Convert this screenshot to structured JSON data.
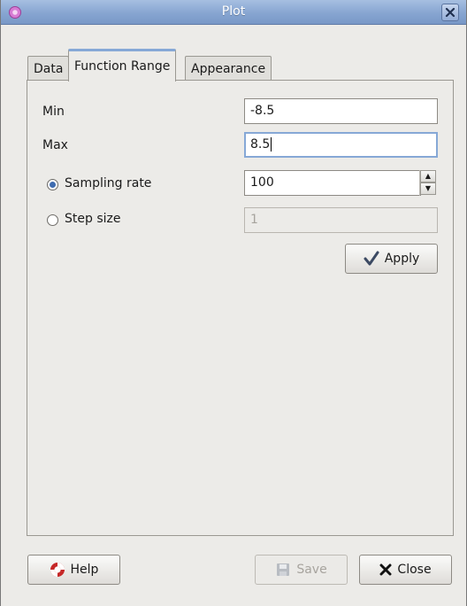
{
  "window": {
    "title": "Plot"
  },
  "tabs": [
    {
      "label": "Data",
      "active": false
    },
    {
      "label": "Function Range",
      "active": true
    },
    {
      "label": "Appearance",
      "active": false
    }
  ],
  "form": {
    "min_label": "Min",
    "min_value": "-8.5",
    "max_label": "Max",
    "max_value": "8.5",
    "sampling_label": "Sampling rate",
    "sampling_value": "100",
    "sampling_selected": true,
    "step_label": "Step size",
    "step_value": "1",
    "step_selected": false
  },
  "buttons": {
    "apply_label": "Apply",
    "help_label": "Help",
    "save_label": "Save",
    "close_label": "Close"
  },
  "colors": {
    "titlebar": "#87a5d1",
    "focus": "#86a8d6",
    "radio_dot": "#3f6cb0"
  }
}
